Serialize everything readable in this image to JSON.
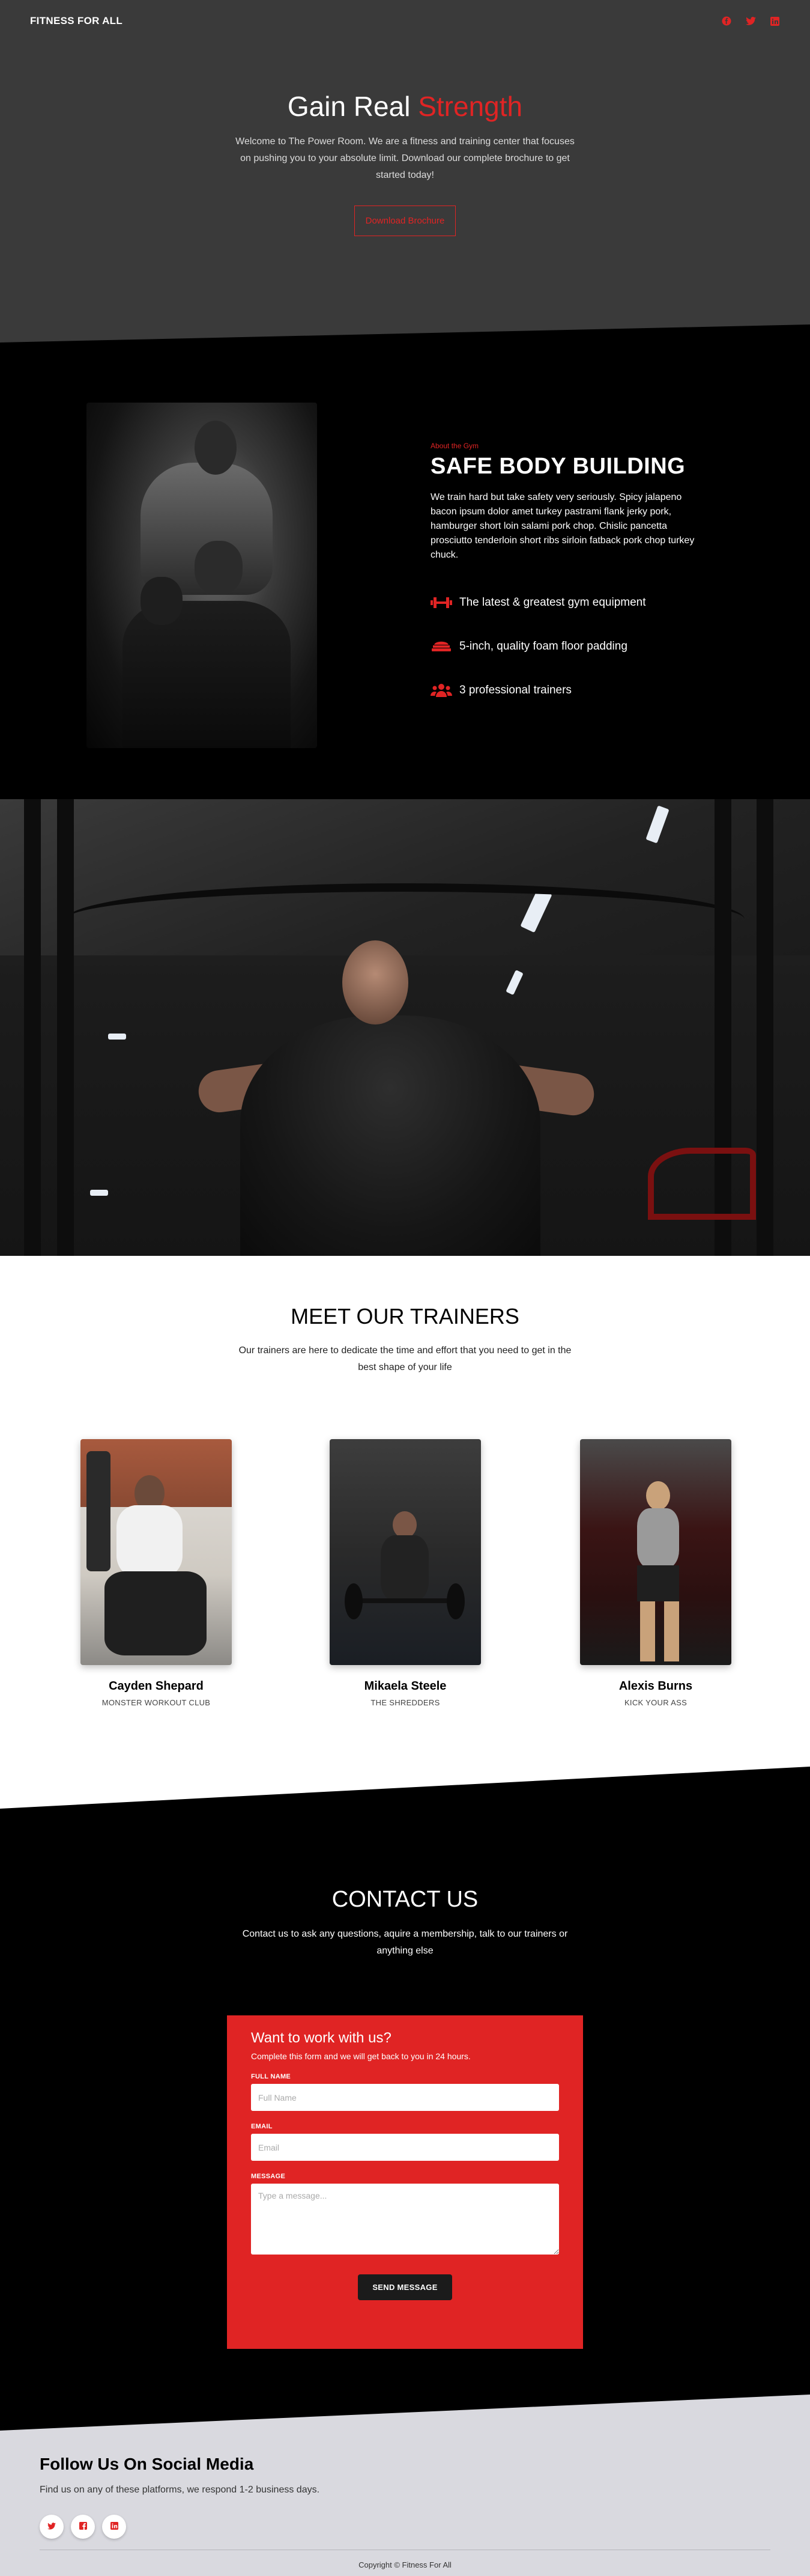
{
  "nav": {
    "brand": "FITNESS FOR ALL",
    "icons": [
      "facebook-icon",
      "twitter-icon",
      "linkedin-icon"
    ]
  },
  "hero": {
    "title_main": "Gain Real",
    "title_accent": "Strength",
    "text": "Welcome to The Power Room. We are a fitness and training center that focuses on pushing you to your absolute limit. Download our complete brochure to get started today!",
    "button": "Download Brochure"
  },
  "about": {
    "eyebrow": "About the Gym",
    "title": "SAFE BODY BUILDING",
    "text": "We train hard but take safety very seriously. Spicy jalapeno bacon ipsum dolor amet turkey pastrami flank jerky pork, hamburger short loin salami pork chop. Chislic pancetta prosciutto tenderloin short ribs sirloin fatback pork chop turkey chuck.",
    "features": [
      {
        "icon": "dumbbell-icon",
        "label": "The latest & greatest gym equipment"
      },
      {
        "icon": "mat-icon",
        "label": "5-inch, quality foam floor padding"
      },
      {
        "icon": "users-icon",
        "label": "3 professional trainers"
      }
    ]
  },
  "trainers": {
    "title": "MEET OUR TRAINERS",
    "subtitle": "Our trainers are here to dedicate the time and effort that you need to get in the best shape of your life",
    "list": [
      {
        "name": "Cayden Shepard",
        "team": "MONSTER WORKOUT CLUB"
      },
      {
        "name": "Mikaela Steele",
        "team": "THE SHREDDERS"
      },
      {
        "name": "Alexis Burns",
        "team": "KICK YOUR ASS"
      }
    ]
  },
  "contact": {
    "title": "CONTACT US",
    "subtitle": "Contact us to ask any questions, aquire a membership, talk to our trainers or anything else",
    "form": {
      "title": "Want to work with us?",
      "subtitle": "Complete this form and we will get back to you in 24 hours.",
      "name_label": "FULL NAME",
      "name_placeholder": "Full Name",
      "email_label": "EMAIL",
      "email_placeholder": "Email",
      "message_label": "MESSAGE",
      "message_placeholder": "Type a message...",
      "button": "SEND MESSAGE"
    }
  },
  "footer": {
    "title": "Follow Us On Social Media",
    "subtitle": "Find us on any of these platforms, we respond 1-2 business days.",
    "socials": [
      "twitter-icon",
      "facebook-icon",
      "linkedin-icon"
    ],
    "copyright": "Copyright © Fitness For All"
  },
  "colors": {
    "accent": "#e02424",
    "hero_bg": "#3a3a3a",
    "dark": "#000000",
    "footer_bg": "#d9d9df"
  }
}
